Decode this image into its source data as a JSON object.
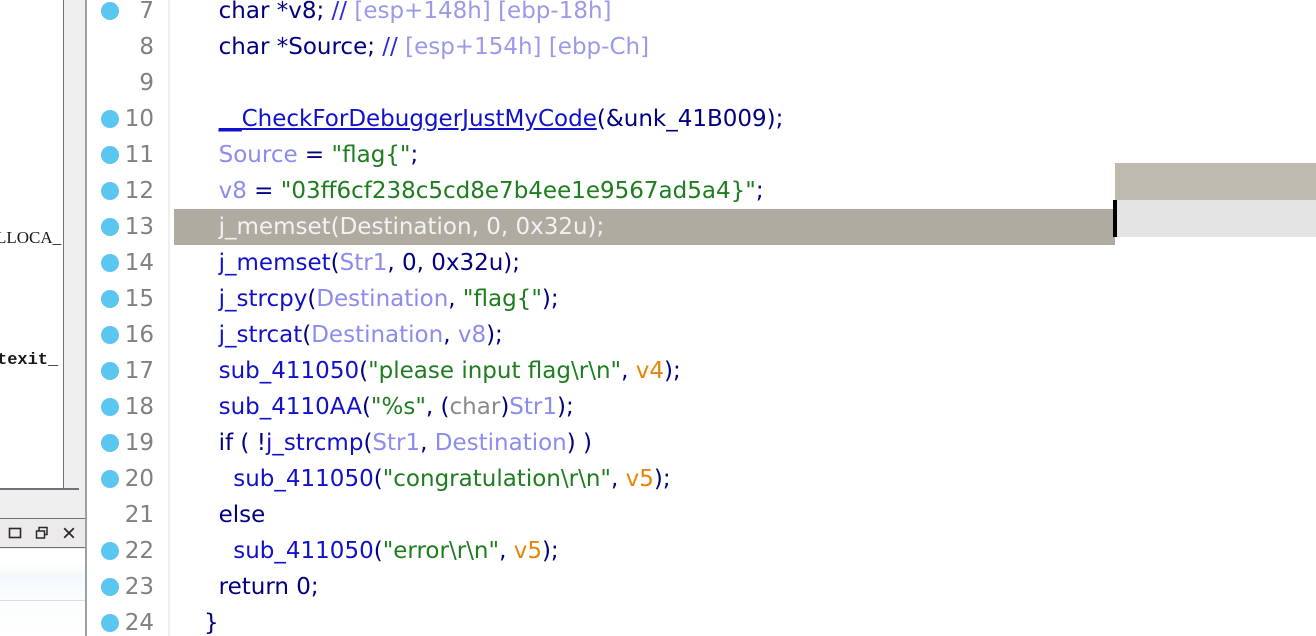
{
  "app": {
    "title": "IDA Pseudocode Decompiler View",
    "theme": {
      "background": "#ffffff",
      "keyword": "#000080",
      "function": "#1111cc",
      "string": "#1e7d1e",
      "variable": "#8b8bf0",
      "comment": "#9a9ae8",
      "number": "#e8840a",
      "breakpoint": "#5BC6F0",
      "current_line_bg": "#b0aba1",
      "line_number": "#808080"
    }
  },
  "background_window": {
    "fragment_symbol": "LLOCA_",
    "fragment_symbol_tail": "_",
    "fragment_mono": "texit_",
    "window_controls": [
      {
        "name": "maximize-button",
        "glyph": "maximize"
      },
      {
        "name": "restore-button",
        "glyph": "restore"
      },
      {
        "name": "close-button",
        "glyph": "close"
      }
    ]
  },
  "right_panel": {
    "band_color": "#bdb9ae",
    "body_color": "#e4e4e4",
    "caret_color": "#000000"
  },
  "editor": {
    "current_line": 13,
    "first_visible_line": 7,
    "last_visible_line": 24,
    "lines": [
      {
        "number": "7",
        "breakpoint": true,
        "indent": 1,
        "tokens": [
          {
            "t": "char ",
            "c": "kw"
          },
          {
            "t": "*v8; ",
            "c": "kw"
          },
          {
            "t": "// ",
            "c": "slash"
          },
          {
            "t": "[esp+148h] [ebp-18h]",
            "c": "cmt"
          }
        ]
      },
      {
        "number": "8",
        "breakpoint": false,
        "indent": 1,
        "tokens": [
          {
            "t": "char ",
            "c": "kw"
          },
          {
            "t": "*Source; ",
            "c": "kw"
          },
          {
            "t": "// ",
            "c": "slash"
          },
          {
            "t": "[esp+154h] [ebp-Ch]",
            "c": "cmt"
          }
        ]
      },
      {
        "number": "9",
        "breakpoint": false,
        "indent": 0,
        "tokens": []
      },
      {
        "number": "10",
        "breakpoint": true,
        "indent": 1,
        "tokens": [
          {
            "t": "__CheckForDebuggerJustMyCode",
            "c": "fn-u"
          },
          {
            "t": "(&unk_41B009);",
            "c": "kw"
          }
        ]
      },
      {
        "number": "11",
        "breakpoint": true,
        "indent": 1,
        "tokens": [
          {
            "t": "Source",
            "c": "var"
          },
          {
            "t": " = ",
            "c": "kw"
          },
          {
            "t": "\"flag{\"",
            "c": "str"
          },
          {
            "t": ";",
            "c": "kw"
          }
        ]
      },
      {
        "number": "12",
        "breakpoint": true,
        "indent": 1,
        "tokens": [
          {
            "t": "v8",
            "c": "var"
          },
          {
            "t": " = ",
            "c": "kw"
          },
          {
            "t": "\"03ff6cf238c5cd8e7b4ee1e9567ad5a4}\"",
            "c": "str"
          },
          {
            "t": ";",
            "c": "kw"
          }
        ]
      },
      {
        "number": "13",
        "breakpoint": true,
        "indent": 1,
        "current": true,
        "tokens": [
          {
            "t": "j_memset(Destination, 0, 0x32u);",
            "c": "white"
          }
        ]
      },
      {
        "number": "14",
        "breakpoint": true,
        "indent": 1,
        "tokens": [
          {
            "t": "j_memset",
            "c": "fn"
          },
          {
            "t": "(",
            "c": "kw"
          },
          {
            "t": "Str1",
            "c": "var"
          },
          {
            "t": ", 0, 0x32u);",
            "c": "kw"
          }
        ]
      },
      {
        "number": "15",
        "breakpoint": true,
        "indent": 1,
        "tokens": [
          {
            "t": "j_strcpy",
            "c": "fn"
          },
          {
            "t": "(",
            "c": "kw"
          },
          {
            "t": "Destination",
            "c": "var"
          },
          {
            "t": ", ",
            "c": "kw"
          },
          {
            "t": "\"flag{\"",
            "c": "str"
          },
          {
            "t": ");",
            "c": "kw"
          }
        ]
      },
      {
        "number": "16",
        "breakpoint": true,
        "indent": 1,
        "tokens": [
          {
            "t": "j_strcat",
            "c": "fn"
          },
          {
            "t": "(",
            "c": "kw"
          },
          {
            "t": "Destination",
            "c": "var"
          },
          {
            "t": ", ",
            "c": "kw"
          },
          {
            "t": "v8",
            "c": "var"
          },
          {
            "t": ");",
            "c": "kw"
          }
        ]
      },
      {
        "number": "17",
        "breakpoint": true,
        "indent": 1,
        "tokens": [
          {
            "t": "sub_411050",
            "c": "fn"
          },
          {
            "t": "(",
            "c": "kw"
          },
          {
            "t": "\"please input flag\\r\\n\"",
            "c": "str"
          },
          {
            "t": ", ",
            "c": "kw"
          },
          {
            "t": "v4",
            "c": "orange"
          },
          {
            "t": ");",
            "c": "kw"
          }
        ]
      },
      {
        "number": "18",
        "breakpoint": true,
        "indent": 1,
        "tokens": [
          {
            "t": "sub_4110AA",
            "c": "fn"
          },
          {
            "t": "(",
            "c": "kw"
          },
          {
            "t": "\"%s\"",
            "c": "str"
          },
          {
            "t": ", (",
            "c": "kw"
          },
          {
            "t": "char",
            "c": "cast"
          },
          {
            "t": ")",
            "c": "kw"
          },
          {
            "t": "Str1",
            "c": "var"
          },
          {
            "t": ");",
            "c": "kw"
          }
        ]
      },
      {
        "number": "19",
        "breakpoint": true,
        "indent": 1,
        "tokens": [
          {
            "t": "if ( !",
            "c": "kw"
          },
          {
            "t": "j_strcmp",
            "c": "fn"
          },
          {
            "t": "(",
            "c": "kw"
          },
          {
            "t": "Str1",
            "c": "var"
          },
          {
            "t": ", ",
            "c": "kw"
          },
          {
            "t": "Destination",
            "c": "var"
          },
          {
            "t": ") )",
            "c": "kw"
          }
        ]
      },
      {
        "number": "20",
        "breakpoint": true,
        "indent": 2,
        "tokens": [
          {
            "t": "sub_411050",
            "c": "fn"
          },
          {
            "t": "(",
            "c": "kw"
          },
          {
            "t": "\"congratulation\\r\\n\"",
            "c": "str"
          },
          {
            "t": ", ",
            "c": "kw"
          },
          {
            "t": "v5",
            "c": "orange"
          },
          {
            "t": ");",
            "c": "kw"
          }
        ]
      },
      {
        "number": "21",
        "breakpoint": false,
        "indent": 1,
        "tokens": [
          {
            "t": "else",
            "c": "kw"
          }
        ]
      },
      {
        "number": "22",
        "breakpoint": true,
        "indent": 2,
        "tokens": [
          {
            "t": "sub_411050",
            "c": "fn"
          },
          {
            "t": "(",
            "c": "kw"
          },
          {
            "t": "\"error\\r\\n\"",
            "c": "str"
          },
          {
            "t": ", ",
            "c": "kw"
          },
          {
            "t": "v5",
            "c": "orange"
          },
          {
            "t": ");",
            "c": "kw"
          }
        ]
      },
      {
        "number": "23",
        "breakpoint": true,
        "indent": 1,
        "tokens": [
          {
            "t": "return 0;",
            "c": "kw"
          }
        ]
      },
      {
        "number": "24",
        "breakpoint": true,
        "indent": 0,
        "tokens": [
          {
            "t": "}",
            "c": "kw"
          }
        ]
      }
    ]
  }
}
